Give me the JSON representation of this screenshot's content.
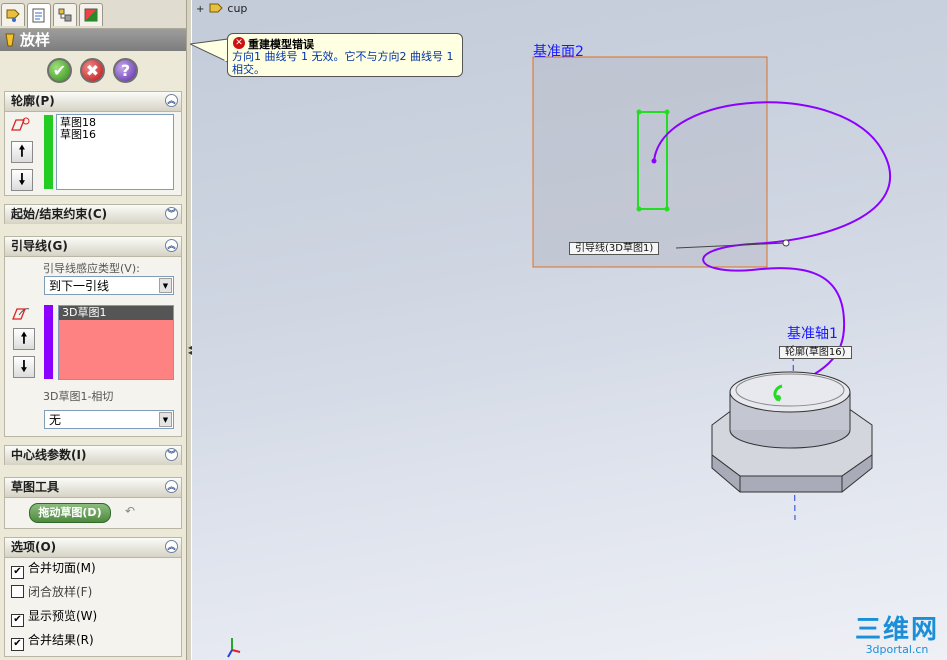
{
  "tabs": [
    {
      "icon": "feature-manager-icon"
    },
    {
      "icon": "property-manager-icon"
    },
    {
      "icon": "configuration-manager-icon"
    },
    {
      "icon": "display-manager-icon"
    }
  ],
  "feature": {
    "title": "放样",
    "icon": "loft-icon"
  },
  "actions": {
    "ok": "✔",
    "cancel": "✖",
    "help": "?"
  },
  "profile": {
    "header": "轮廓(P)",
    "items": [
      "草图18",
      "草图16"
    ],
    "color": "#22cc22"
  },
  "start_end": {
    "header": "起始/结束约束(C)"
  },
  "guides": {
    "header": "引导线(G)",
    "type_label": "引导线感应类型(V):",
    "type_value": "到下一引线",
    "items": [
      "3D草图1"
    ],
    "color": "#8b00ff",
    "tangency_label": "3D草图1-相切",
    "tangency_value": "无"
  },
  "centerline": {
    "header": "中心线参数(I)"
  },
  "sketch_tools": {
    "header": "草图工具",
    "drag_button": "拖动草图(D)"
  },
  "options": {
    "header": "选项(O)",
    "items": [
      {
        "label": "合并切面(M)",
        "checked": true
      },
      {
        "label": "闭合放样(F)",
        "checked": false
      },
      {
        "label": "显示预览(W)",
        "checked": true
      },
      {
        "label": "合并结果(R)",
        "checked": true
      }
    ]
  },
  "tree_root": "cup",
  "error_tip": {
    "title": "重建模型错误",
    "message": "方向1 曲线号 1 无效。它不与方向2 曲线号 1 相交。"
  },
  "viewport": {
    "plane_label": "基准面2",
    "axis_label": "基准轴1",
    "guide_tag": "引导线(3D草图1)",
    "profile_tag": "轮廓(草图16)"
  },
  "watermark": {
    "big": "三维网",
    "small": "3dportal.cn"
  }
}
